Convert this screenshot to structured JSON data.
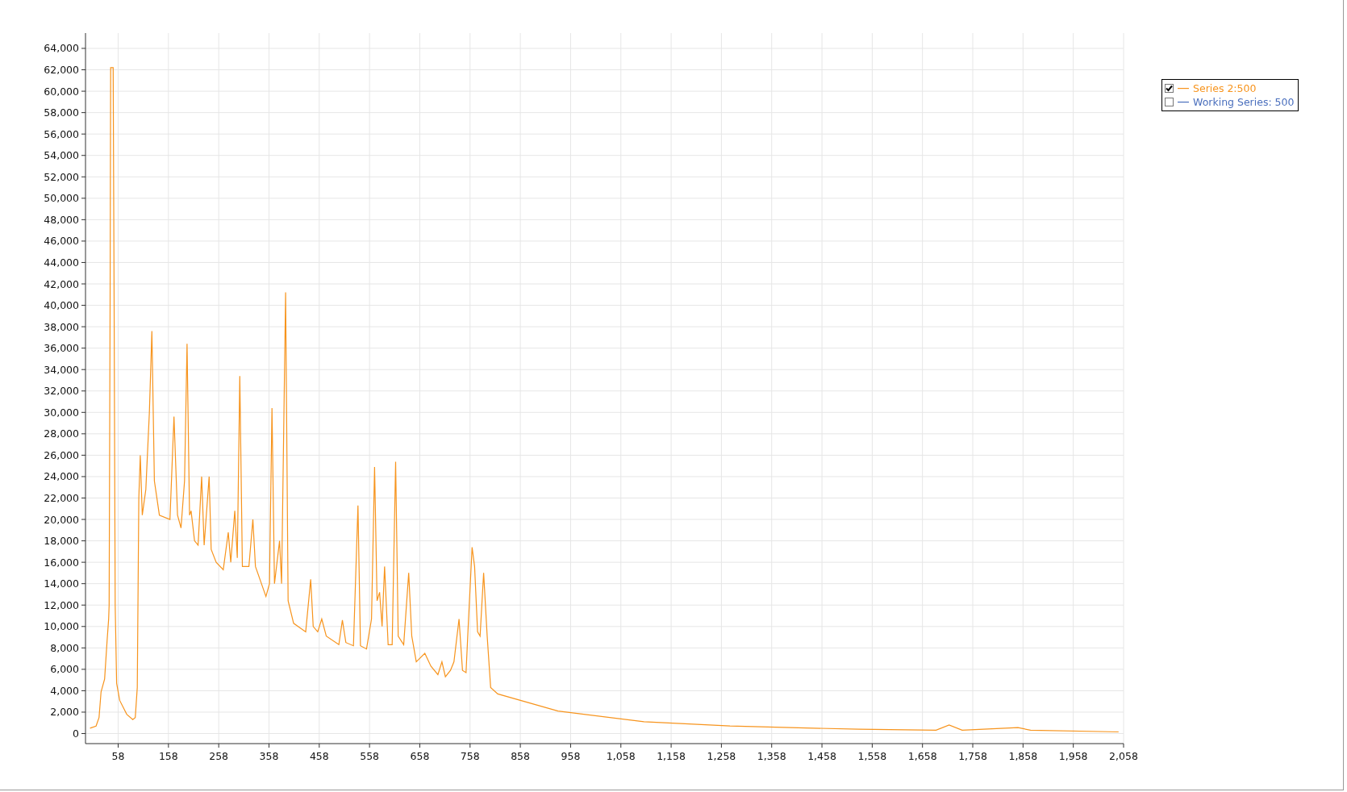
{
  "chart": {
    "chart_data": {
      "type": "line",
      "grid": true,
      "xlim": [
        -7,
        2058
      ],
      "ylim": [
        -940,
        65430
      ],
      "xticks": [
        {
          "value": 58,
          "label": "58"
        },
        {
          "value": 158,
          "label": "158"
        },
        {
          "value": 258,
          "label": "258"
        },
        {
          "value": 358,
          "label": "358"
        },
        {
          "value": 458,
          "label": "458"
        },
        {
          "value": 558,
          "label": "558"
        },
        {
          "value": 658,
          "label": "658"
        },
        {
          "value": 758,
          "label": "758"
        },
        {
          "value": 858,
          "label": "858"
        },
        {
          "value": 958,
          "label": "958"
        },
        {
          "value": 1058,
          "label": "1,058"
        },
        {
          "value": 1158,
          "label": "1,158"
        },
        {
          "value": 1258,
          "label": "1,258"
        },
        {
          "value": 1358,
          "label": "1,358"
        },
        {
          "value": 1458,
          "label": "1,458"
        },
        {
          "value": 1558,
          "label": "1,558"
        },
        {
          "value": 1658,
          "label": "1,658"
        },
        {
          "value": 1758,
          "label": "1,758"
        },
        {
          "value": 1858,
          "label": "1,858"
        },
        {
          "value": 1958,
          "label": "1,958"
        },
        {
          "value": 2058,
          "label": "2,058"
        }
      ],
      "yticks": [
        {
          "value": 0,
          "label": "0"
        },
        {
          "value": 2000,
          "label": "2,000"
        },
        {
          "value": 4000,
          "label": "4,000"
        },
        {
          "value": 6000,
          "label": "6,000"
        },
        {
          "value": 8000,
          "label": "8,000"
        },
        {
          "value": 10000,
          "label": "10,000"
        },
        {
          "value": 12000,
          "label": "12,000"
        },
        {
          "value": 14000,
          "label": "14,000"
        },
        {
          "value": 16000,
          "label": "16,000"
        },
        {
          "value": 18000,
          "label": "18,000"
        },
        {
          "value": 20000,
          "label": "20,000"
        },
        {
          "value": 22000,
          "label": "22,000"
        },
        {
          "value": 24000,
          "label": "24,000"
        },
        {
          "value": 26000,
          "label": "26,000"
        },
        {
          "value": 28000,
          "label": "28,000"
        },
        {
          "value": 30000,
          "label": "30,000"
        },
        {
          "value": 32000,
          "label": "32,000"
        },
        {
          "value": 34000,
          "label": "34,000"
        },
        {
          "value": 36000,
          "label": "36,000"
        },
        {
          "value": 38000,
          "label": "38,000"
        },
        {
          "value": 40000,
          "label": "40,000"
        },
        {
          "value": 42000,
          "label": "42,000"
        },
        {
          "value": 44000,
          "label": "44,000"
        },
        {
          "value": 46000,
          "label": "46,000"
        },
        {
          "value": 48000,
          "label": "48,000"
        },
        {
          "value": 50000,
          "label": "50,000"
        },
        {
          "value": 52000,
          "label": "52,000"
        },
        {
          "value": 54000,
          "label": "54,000"
        },
        {
          "value": 56000,
          "label": "56,000"
        },
        {
          "value": 58000,
          "label": "58,000"
        },
        {
          "value": 60000,
          "label": "60,000"
        },
        {
          "value": 62000,
          "label": "62,000"
        },
        {
          "value": 64000,
          "label": "64,000"
        }
      ],
      "x": [
        2,
        14,
        20,
        24,
        31,
        36,
        39,
        40,
        42,
        43,
        48,
        50,
        52,
        55,
        61,
        75,
        87,
        92,
        96,
        99,
        102,
        106,
        113,
        120,
        125,
        130,
        140,
        161,
        169,
        176,
        183,
        190,
        195,
        200,
        203,
        210,
        217,
        224,
        229,
        239,
        243,
        253,
        267,
        277,
        282,
        290,
        295,
        300,
        305,
        318,
        326,
        331,
        352,
        359,
        364,
        369,
        379,
        383,
        391,
        396,
        407,
        431,
        441,
        446,
        455,
        463,
        472,
        497,
        504,
        511,
        526,
        535,
        540,
        552,
        562,
        568,
        573,
        578,
        583,
        588,
        595,
        603,
        610,
        615,
        626,
        636,
        642,
        651,
        668,
        680,
        694,
        702,
        709,
        719,
        726,
        736,
        743,
        750,
        755,
        762,
        767,
        773,
        778,
        785,
        792,
        799,
        813,
        933,
        1104,
        1275,
        1531,
        1685,
        1711,
        1737,
        1848,
        1873,
        2048
      ],
      "series": [
        {
          "name": "Series 2:500",
          "color": "#f7941d",
          "values": [
            500,
            700,
            1500,
            3900,
            5100,
            8700,
            10700,
            12000,
            40000,
            62200,
            62200,
            40000,
            12000,
            4700,
            3100,
            1800,
            1300,
            1500,
            4300,
            22000,
            26000,
            20400,
            22800,
            30000,
            37600,
            23600,
            20400,
            20000,
            29600,
            20400,
            19200,
            23600,
            36400,
            20400,
            20800,
            18000,
            17600,
            24000,
            17600,
            24000,
            17200,
            16000,
            15300,
            18800,
            16000,
            20800,
            16400,
            33400,
            15600,
            15600,
            20000,
            15600,
            12800,
            14000,
            30400,
            14000,
            18000,
            14000,
            41200,
            12400,
            10300,
            9500,
            14400,
            10000,
            9500,
            10700,
            9100,
            8300,
            10600,
            8500,
            8200,
            21300,
            8200,
            7900,
            10700,
            24900,
            12400,
            13200,
            10000,
            15600,
            8300,
            8300,
            25400,
            9100,
            8300,
            15000,
            9100,
            6700,
            7500,
            6300,
            5500,
            6700,
            5300,
            5900,
            6700,
            10700,
            5900,
            5700,
            10700,
            17400,
            15600,
            9500,
            9100,
            15000,
            9100,
            4300,
            3700,
            2100,
            1100,
            700,
            400,
            320,
            800,
            320,
            550,
            320,
            150
          ]
        }
      ]
    }
  },
  "legend": [
    {
      "checked": true
    },
    {
      "label": "Working Series: 500",
      "color": "#4a6fbd",
      "checked": false
    }
  ]
}
